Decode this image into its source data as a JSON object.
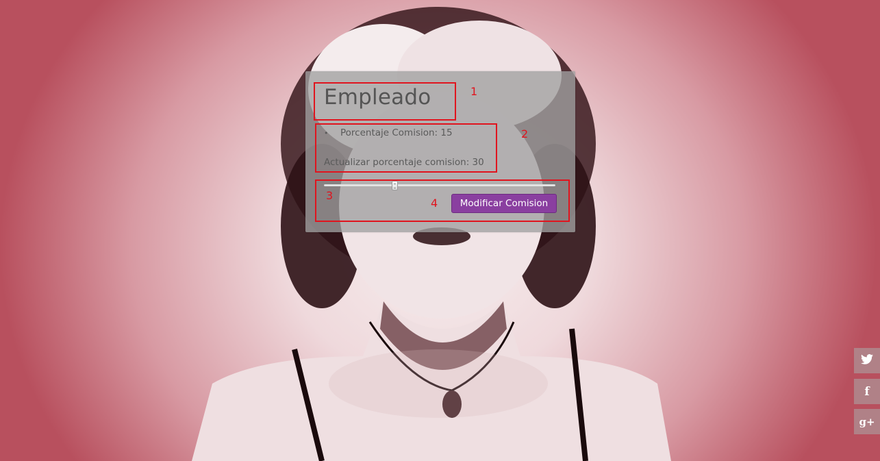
{
  "card": {
    "title": "Empleado",
    "bullet": "•",
    "percent_label": "Porcentaje Comision: 15",
    "update_label": "Actualizar porcentaje comision: 30",
    "slider_value": 30,
    "slider_min": 0,
    "slider_max": 100,
    "button_label": "Modificar Comision",
    "button_color": "#8a3fa0"
  },
  "annotations": [
    "1",
    "2",
    "3",
    "4"
  ],
  "annotation_color": "#e0141e",
  "social": [
    {
      "icon": "twitter-icon",
      "glyph": "🐦︎"
    },
    {
      "icon": "facebook-icon",
      "glyph": "f"
    },
    {
      "icon": "google-plus-icon",
      "glyph": "g+"
    }
  ]
}
